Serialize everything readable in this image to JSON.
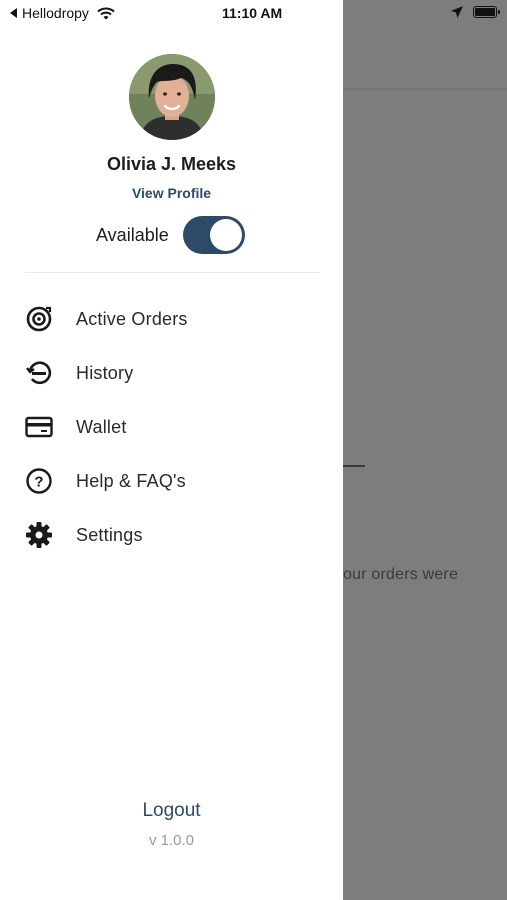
{
  "status_bar": {
    "back_app": "Hellodropy",
    "time": "11:10 AM"
  },
  "profile": {
    "name": "Olivia J. Meeks",
    "view_profile": "View Profile",
    "availability_label": "Available",
    "available": true
  },
  "menu": {
    "items": [
      {
        "label": "Active Orders",
        "icon": "target-icon"
      },
      {
        "label": "History",
        "icon": "history-icon"
      },
      {
        "label": "Wallet",
        "icon": "card-icon"
      },
      {
        "label": "Help & FAQ's",
        "icon": "help-icon"
      },
      {
        "label": "Settings",
        "icon": "gear-icon"
      }
    ]
  },
  "footer": {
    "logout": "Logout",
    "version": "v 1.0.0"
  },
  "background": {
    "partial_text": "our orders were"
  }
}
